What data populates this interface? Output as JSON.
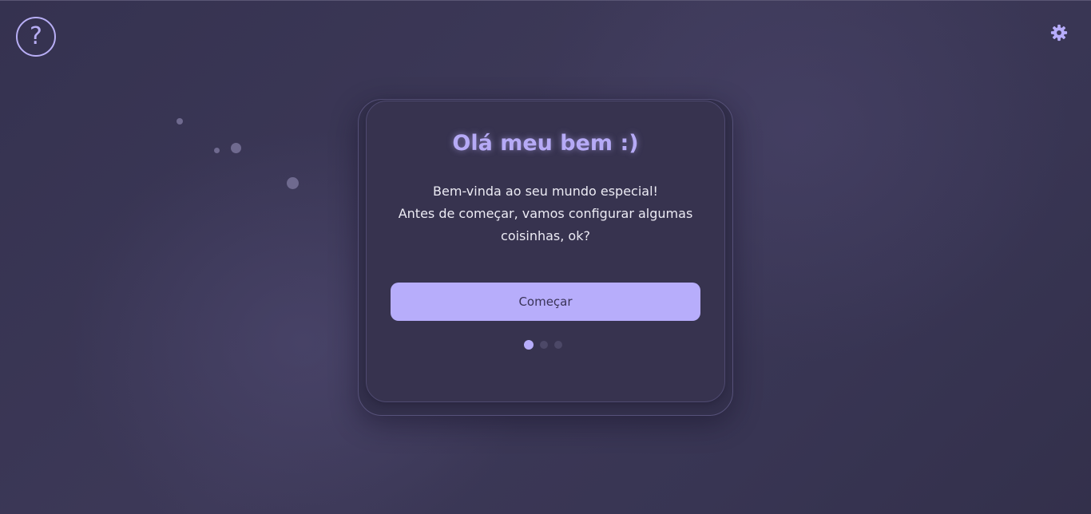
{
  "header": {
    "help_icon": "question-mark-icon",
    "help_glyph": "?",
    "settings_icon": "gear-icon"
  },
  "welcome_card": {
    "title": "Olá meu bem :)",
    "message_lines": [
      "Bem-vinda ao seu mundo especial!",
      "Antes de começar, vamos configurar algumas",
      "coisinhas, ok?"
    ],
    "start_button_label": "Começar",
    "step_indicator": {
      "total_steps": 3,
      "current_step": 1
    }
  },
  "colors": {
    "accent": "#b7adfb",
    "title": "#b6aaf6",
    "background": "#373453",
    "card": "#37334f",
    "text": "#ecebf4"
  }
}
